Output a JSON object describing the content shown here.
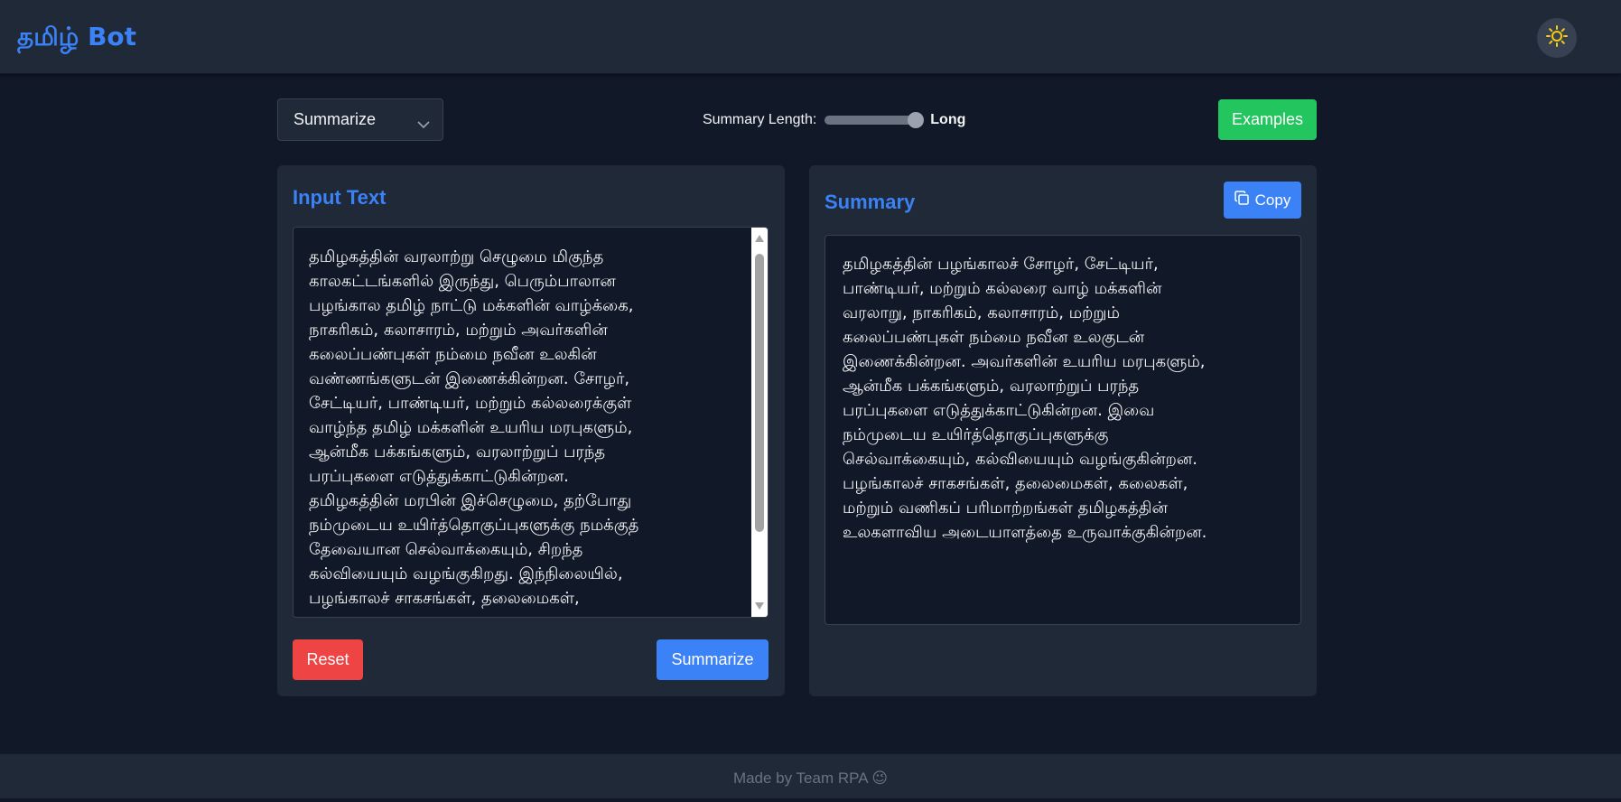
{
  "app": {
    "brand": "தமிழ் Bot",
    "theme_icon": "sun-icon"
  },
  "controls": {
    "mode_selected": "Summarize",
    "summary_length_label": "Summary Length:",
    "summary_length_value": "Long",
    "summary_length_level": 1.0,
    "examples_label": "Examples"
  },
  "input_panel": {
    "title": "Input Text",
    "text": "தமிழகத்தின் வரலாற்று செழுமை மிகுந்த\nகாலகட்டங்களில் இருந்து, பெரும்பாலான\nபழங்கால தமிழ் நாட்டு மக்களின் வாழ்க்கை,\nநாகரிகம், கலாசாரம், மற்றும் அவர்களின்\nகலைப்பண்புகள் நம்மை நவீன உலகின்\nவண்ணங்களுடன் இணைக்கின்றன. சோழர்,\nசேட்டியர், பாண்டியர், மற்றும் கல்லரைக்குள்\nவாழ்ந்த தமிழ் மக்களின் உயரிய மரபுகளும்,\nஆன்மீக பக்கங்களும், வரலாற்றுப் பரந்த\nபரப்புகளை எடுத்துக்காட்டுகின்றன.\nதமிழகத்தின் மரபின் இச்செழுமை, தற்போது\nநம்முடைய உயிர்த்தொகுப்புகளுக்கு நமக்குத்\nதேவையான செல்வாக்கையும், சிறந்த\nகல்வியையும் வழங்குகிறது. இந்நிலையில்,\nபழங்காலச் சாகசங்கள், தலைமைகள்,",
    "reset_label": "Reset",
    "summarize_label": "Summarize"
  },
  "summary_panel": {
    "title": "Summary",
    "copy_label": "Copy",
    "text": "தமிழகத்தின் பழங்காலச் சோழர், சேட்டியர்,\nபாண்டியர், மற்றும் கல்லரை வாழ் மக்களின்\nவரலாறு, நாகரிகம், கலாசாரம், மற்றும்\nகலைப்பண்புகள் நம்மை நவீன உலகுடன்\nஇணைக்கின்றன. அவர்களின் உயரிய மரபுகளும்,\nஆன்மீக பக்கங்களும், வரலாற்றுப் பரந்த\nபரப்புகளை எடுத்துக்காட்டுகின்றன. இவை\nநம்முடைய உயிர்த்தொகுப்புகளுக்கு\nசெல்வாக்கையும், கல்வியையும் வழங்குகின்றன.\nபழங்காலச் சாகசங்கள், தலைமைகள், கலைகள்,\nமற்றும் வணிகப் பரிமாற்றங்கள் தமிழகத்தின்\nஉலகளாவிய அடையாளத்தை உருவாக்குகின்றன."
  },
  "footer": {
    "text": "Made by Team RPA 😉"
  },
  "colors": {
    "background": "#111827",
    "panel": "#1f2937",
    "accent": "#3b82f6",
    "success": "#22c55e",
    "danger": "#ef4444"
  }
}
